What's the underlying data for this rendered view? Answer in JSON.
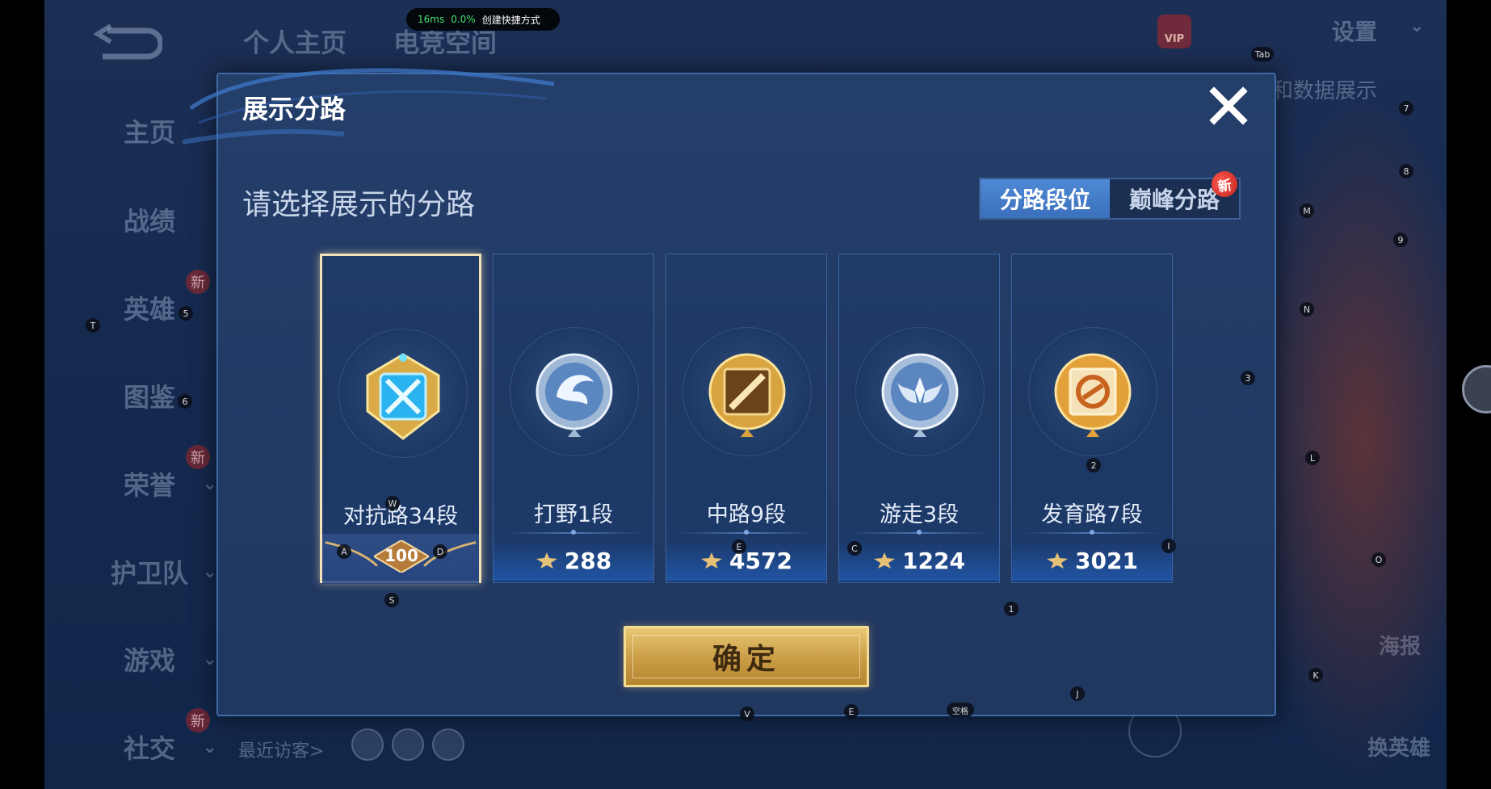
{
  "perf": {
    "latency": "16ms",
    "cpu": "0.0%",
    "shortcut": "创建快捷方式"
  },
  "background": {
    "tabs": [
      "个人主页",
      "电竞空间"
    ],
    "settings": "设置",
    "data_link": "和数据展示",
    "nav": [
      {
        "label": "主页",
        "new": false,
        "chevron": false
      },
      {
        "label": "战绩",
        "new": false,
        "chevron": false
      },
      {
        "label": "英雄",
        "new": true,
        "chevron": false
      },
      {
        "label": "图鉴",
        "new": false,
        "chevron": false
      },
      {
        "label": "荣誉",
        "new": true,
        "chevron": true
      },
      {
        "label": "护卫队",
        "new": false,
        "chevron": true
      },
      {
        "label": "游戏",
        "new": false,
        "chevron": true
      },
      {
        "label": "社交",
        "new": true,
        "chevron": true
      }
    ],
    "new_badge": "新",
    "recent_visitors": "最近访客>",
    "poster": "海报",
    "switch_hero": "换英雄"
  },
  "dialog": {
    "title": "展示分路",
    "prompt": "请选择展示的分路",
    "tabs": [
      {
        "label": "分路段位",
        "active": true
      },
      {
        "label": "巅峰分路",
        "active": false,
        "badge": "新"
      }
    ],
    "cards": [
      {
        "name": "对抗路34段",
        "score": "100",
        "selected": true,
        "emblem": "sword-emblem-icon"
      },
      {
        "name": "打野1段",
        "score": "288",
        "selected": false,
        "emblem": "dragon-emblem-icon"
      },
      {
        "name": "中路9段",
        "score": "4572",
        "selected": false,
        "emblem": "staff-emblem-icon"
      },
      {
        "name": "游走3段",
        "score": "1224",
        "selected": false,
        "emblem": "wings-emblem-icon"
      },
      {
        "name": "发育路7段",
        "score": "3021",
        "selected": false,
        "emblem": "s-emblem-icon"
      }
    ],
    "confirm": "确定"
  },
  "key_hints": [
    "T",
    "5",
    "6",
    "W",
    "A",
    "D",
    "S",
    "E",
    "C",
    "2",
    "I",
    "1",
    "V",
    "E",
    "空格",
    "J",
    "3",
    "Tab",
    "7",
    "8",
    "M",
    "9",
    "N",
    "L",
    "O",
    "K"
  ],
  "colors": {
    "dialog_bg": "#233c67",
    "accent_blue": "#3f6aa6",
    "gold": "#d4a94f",
    "selected_border": "#f3e2b8"
  }
}
